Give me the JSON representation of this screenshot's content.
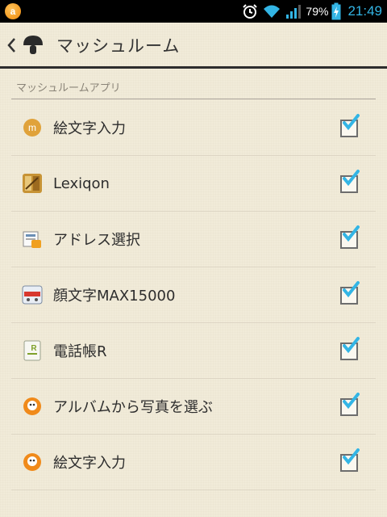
{
  "status_bar": {
    "battery_percent": "79%",
    "time": "21:49",
    "icons": [
      "app-notification-icon",
      "alarm-clock-icon",
      "wifi-icon",
      "cell-signal-icon",
      "battery-charging-icon"
    ]
  },
  "action_bar": {
    "title": "マッシュルーム",
    "icons": [
      "back-chevron-icon",
      "mushroom-logo-icon"
    ]
  },
  "section": {
    "header": "マッシュルームアプリ"
  },
  "items": [
    {
      "label": "絵文字入力",
      "icon": "emoji-input-m-icon",
      "checked": true
    },
    {
      "label": "Lexiqon",
      "icon": "lexiqon-app-icon",
      "checked": true
    },
    {
      "label": "アドレス選択",
      "icon": "address-book-icon",
      "checked": true
    },
    {
      "label": "顔文字MAX15000",
      "icon": "kaomoji-max-icon",
      "checked": true
    },
    {
      "label": "電話帳R",
      "icon": "phonebook-r-icon",
      "checked": true
    },
    {
      "label": "アルバムから写真を選ぶ",
      "icon": "album-photo-icon",
      "checked": true
    },
    {
      "label": "絵文字入力",
      "icon": "emoji-input-orange-icon",
      "checked": true
    }
  ],
  "colors": {
    "background": "#f1ebd9",
    "status_bar": "#000000",
    "time_accent": "#33b5e5",
    "check_accent": "#33b5e5"
  }
}
